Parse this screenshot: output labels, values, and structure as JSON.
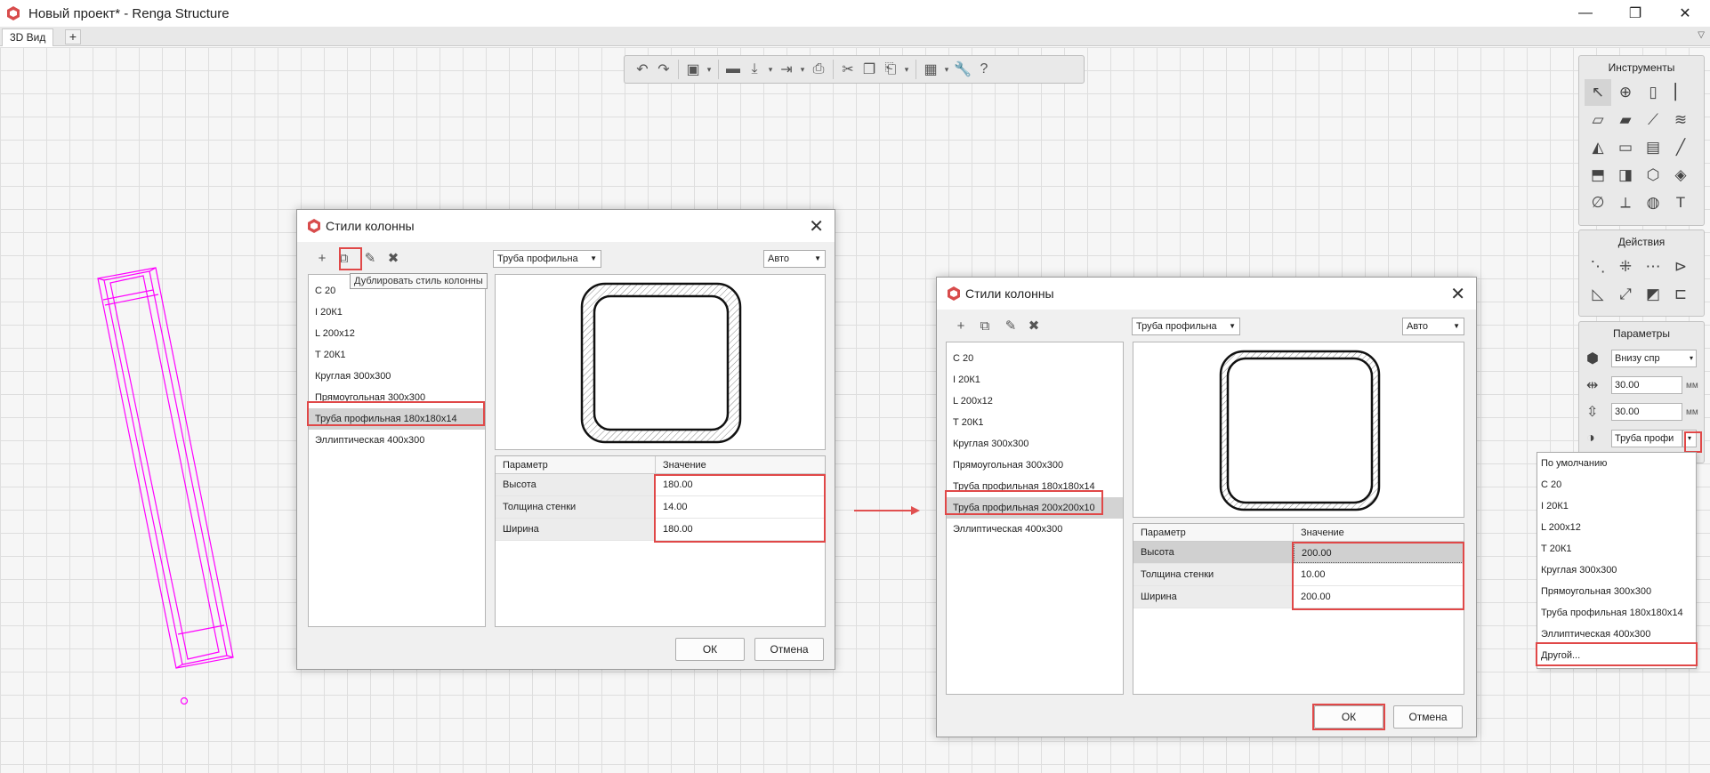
{
  "app": {
    "title": "Новый проект* - Renga Structure"
  },
  "window_controls": {
    "minimize": "—",
    "maximize": "❐",
    "close": "✕"
  },
  "tabs": [
    {
      "label": "3D Вид"
    }
  ],
  "tab_add": "+",
  "tab_menu": "▽",
  "panels": {
    "tools_title": "Инструменты",
    "actions_title": "Действия",
    "params_title": "Параметры",
    "param_rows": [
      {
        "value": "Внизу спр",
        "has_arrow": true
      },
      {
        "value": "30.00",
        "unit": "мм"
      },
      {
        "value": "30.00",
        "unit": "мм"
      },
      {
        "value": "Труба профи",
        "has_arrow": true
      }
    ]
  },
  "column_style_dropdown": {
    "items": [
      "По умолчанию",
      "С 20",
      "I 20К1",
      "L 200х12",
      "Т 20К1",
      "Круглая 300х300",
      "Прямоугольная 300х300",
      "Труба профильная 180х180х14",
      "Эллиптическая 400х300",
      "Другой..."
    ]
  },
  "dialog1": {
    "title": "Стили колонны",
    "tooltip": "Дублировать стиль колонны",
    "profile_select": "Труба профильна",
    "mode_select": "Авто",
    "styles": [
      "С 20",
      "I 20К1",
      "L 200х12",
      "Т 20К1",
      "Круглая 300х300",
      "Прямоугольная 300х300",
      "Труба профильная 180х180х14",
      "Эллиптическая 400х300"
    ],
    "selected_index": 6,
    "table_header": {
      "param": "Параметр",
      "value": "Значение"
    },
    "params": [
      {
        "name": "Высота",
        "value": "180.00"
      },
      {
        "name": "Толщина стенки",
        "value": "14.00"
      },
      {
        "name": "Ширина",
        "value": "180.00"
      }
    ],
    "ok": "ОК",
    "cancel": "Отмена"
  },
  "dialog2": {
    "title": "Стили колонны",
    "profile_select": "Труба профильна",
    "mode_select": "Авто",
    "styles": [
      "С 20",
      "I 20К1",
      "L 200х12",
      "Т 20К1",
      "Круглая 300х300",
      "Прямоугольная 300х300",
      "Труба профильная 180х180х14",
      "Труба профильная 200х200х10",
      "Эллиптическая 400х300"
    ],
    "selected_index": 7,
    "table_header": {
      "param": "Параметр",
      "value": "Значение"
    },
    "params": [
      {
        "name": "Высота",
        "value": "200.00"
      },
      {
        "name": "Толщина стенки",
        "value": "10.00"
      },
      {
        "name": "Ширина",
        "value": "200.00"
      }
    ],
    "ok": "ОК",
    "cancel": "Отмена"
  },
  "colors": {
    "highlight": "#e04848",
    "column_wire": "#ff00ff",
    "arrow": "#e05050"
  }
}
